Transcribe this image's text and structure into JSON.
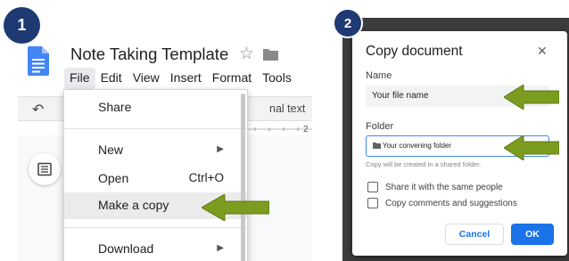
{
  "steps": {
    "one": "1",
    "two": "2"
  },
  "document": {
    "title": "Note Taking Template"
  },
  "menubar": [
    "File",
    "Edit",
    "View",
    "Insert",
    "Format",
    "Tools"
  ],
  "toolbar": {
    "style_text": "nal text",
    "ruler_number": "2"
  },
  "file_menu": {
    "share": "Share",
    "new": "New",
    "open": "Open",
    "open_shortcut": "Ctrl+O",
    "make_copy": "Make a copy",
    "download": "Download"
  },
  "dialog": {
    "title": "Copy document",
    "name_label": "Name",
    "name_value": "Your file name",
    "folder_label": "Folder",
    "folder_value": "Your convening folder",
    "folder_hint": "Copy will be created in a shared folder.",
    "share_option": "Share it with the same people",
    "comments_option": "Copy comments and suggestions",
    "cancel": "Cancel",
    "ok": "OK"
  },
  "colors": {
    "step_badge": "#1f3a73",
    "callout_arrow": "#7b9c1f",
    "docs_blue": "#4285f4",
    "primary_button": "#1a73e8",
    "dark_overlay": "#3c3c3c"
  },
  "icons": [
    "docs-logo-icon",
    "star-icon",
    "folder-icon",
    "undo-icon",
    "redo-icon",
    "outline-icon",
    "close-icon",
    "chevron-right-icon",
    "arrow-left-icon"
  ]
}
